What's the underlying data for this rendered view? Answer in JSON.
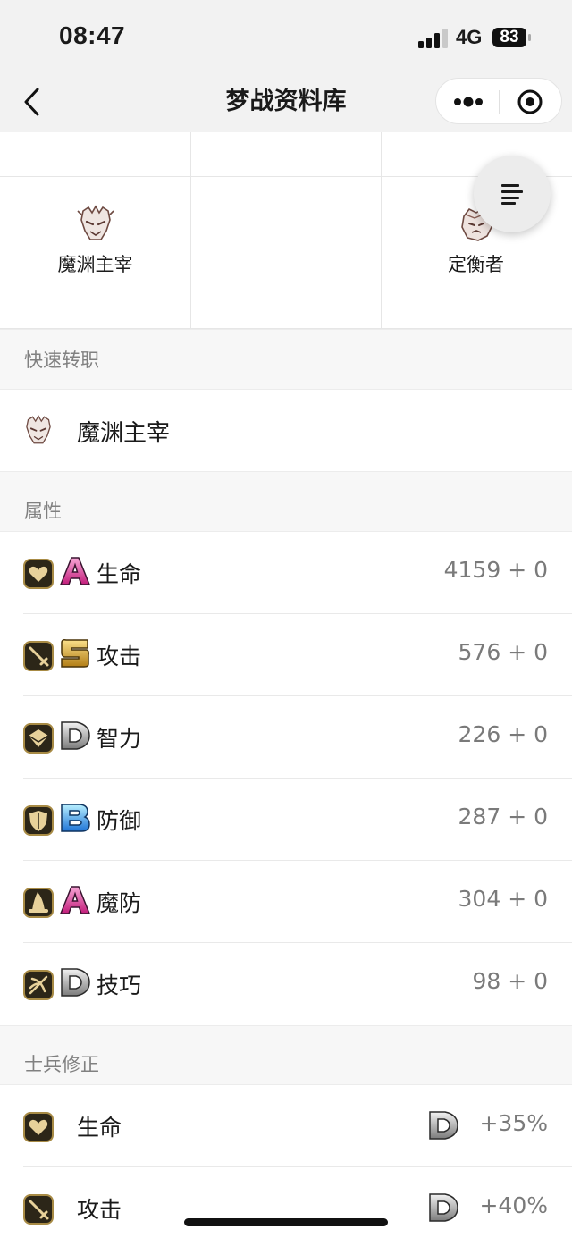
{
  "status_bar": {
    "time": "08:47",
    "network": "4G",
    "battery": "83"
  },
  "nav": {
    "title": "梦战资料库"
  },
  "class_grid": {
    "items": [
      {
        "name": "魔渊主宰"
      },
      {
        "name": "定衡者"
      }
    ]
  },
  "quick_change": {
    "header": "快速转职",
    "item": "魔渊主宰"
  },
  "attributes": {
    "header": "属性",
    "rows": [
      {
        "icon": "heart-icon",
        "grade": "A",
        "label": "生命",
        "value": "4159 + 0"
      },
      {
        "icon": "sword-icon",
        "grade": "S",
        "label": "攻击",
        "value": "576 + 0"
      },
      {
        "icon": "book-icon",
        "grade": "D",
        "label": "智力",
        "value": "226 + 0"
      },
      {
        "icon": "shield-icon",
        "grade": "B",
        "label": "防御",
        "value": "287 + 0"
      },
      {
        "icon": "wizard-hat-icon",
        "grade": "A",
        "label": "魔防",
        "value": "304 + 0"
      },
      {
        "icon": "skill-icon",
        "grade": "D",
        "label": "技巧",
        "value": "98 + 0"
      }
    ]
  },
  "soldier_mod": {
    "header": "士兵修正",
    "rows": [
      {
        "icon": "heart-icon",
        "label": "生命",
        "grade": "D",
        "value": "+35%"
      },
      {
        "icon": "sword-icon",
        "label": "攻击",
        "grade": "D",
        "value": "+40%"
      }
    ]
  },
  "colors": {
    "grade_A": "#e0459a",
    "grade_S": "#d9a826",
    "grade_D": "#8a8a8a",
    "grade_B": "#3aa7e8",
    "stat_icon_bg": "#2c2618",
    "stat_icon_border": "#a88b45"
  }
}
